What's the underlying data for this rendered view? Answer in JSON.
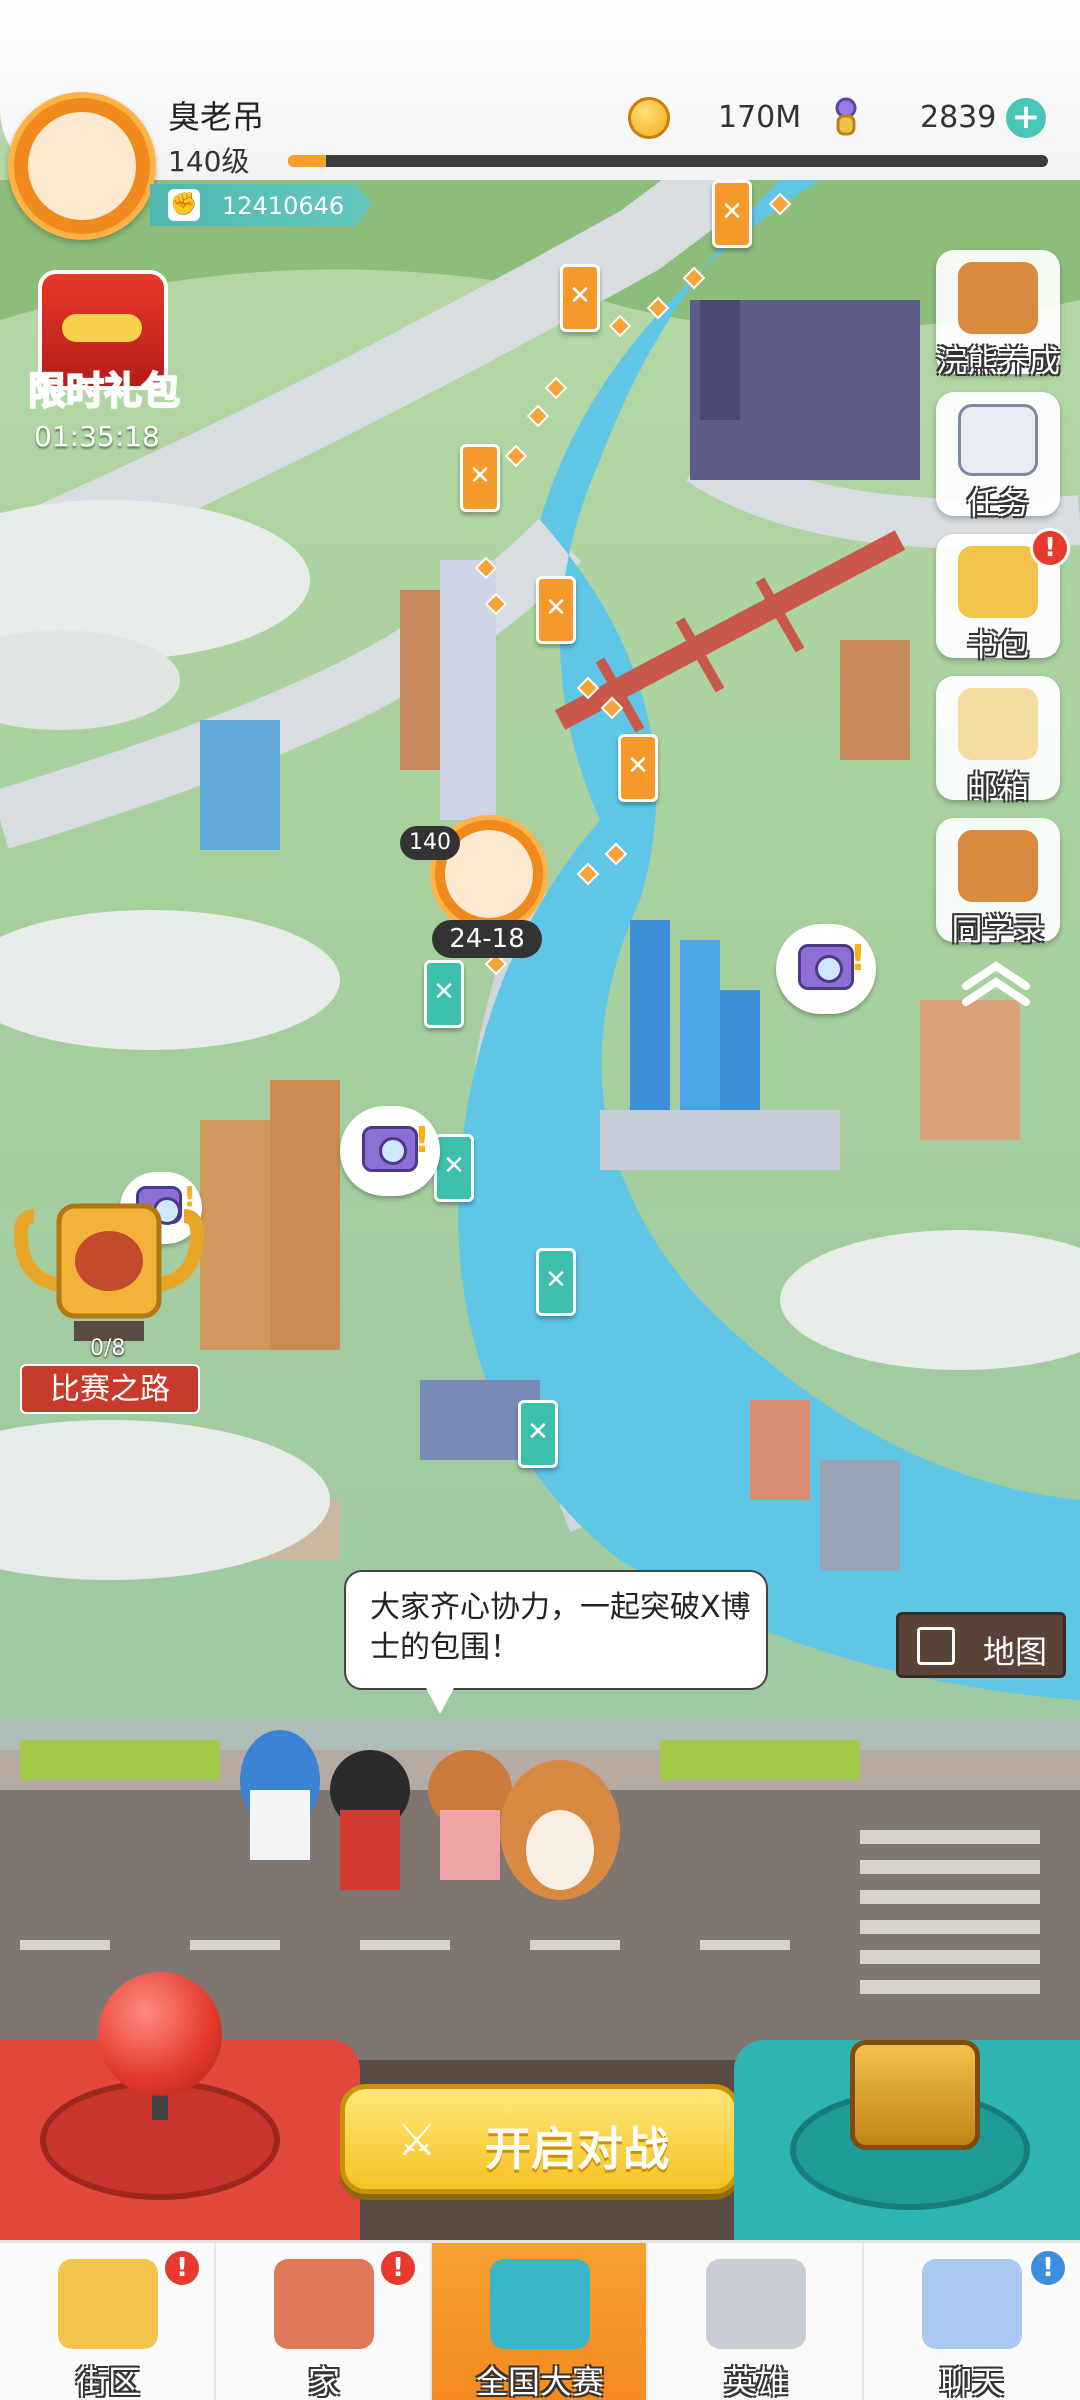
{
  "player": {
    "name": "臭老吊",
    "level_text": "140级",
    "xp_fraction": 0.05,
    "power": "12410646"
  },
  "currency": {
    "coins": "170M",
    "gems": "2839"
  },
  "gift": {
    "label": "限时礼包",
    "timer": "01:35:18"
  },
  "side_menu": {
    "items": [
      {
        "label": "浣熊养成",
        "icon": "raccoon-icon",
        "badge": ""
      },
      {
        "label": "任务",
        "icon": "clipboard-icon",
        "badge": ""
      },
      {
        "label": "书包",
        "icon": "backpack-icon",
        "badge": "!"
      },
      {
        "label": "邮箱",
        "icon": "envelope-icon",
        "badge": ""
      },
      {
        "label": "同学录",
        "icon": "raccoon-book-icon",
        "badge": ""
      }
    ]
  },
  "map": {
    "player_marker_level": "140",
    "current_stage": "24-18",
    "trophy_progress": "0/8",
    "trophy_label": "比赛之路",
    "speech_text": "大家齐心协力，一起突破X博士的包围！",
    "map_sign_label": "地图"
  },
  "fight_button": {
    "label": "开启对战"
  },
  "bottom_nav": {
    "items": [
      {
        "label": "街区",
        "icon": "street-sign-icon",
        "badge": "!"
      },
      {
        "label": "家",
        "icon": "house-icon",
        "badge": "!"
      },
      {
        "label": "全国大赛",
        "icon": "trophy-icon",
        "badge": ""
      },
      {
        "label": "英雄",
        "icon": "hero-cards-icon",
        "badge": ""
      },
      {
        "label": "聊天",
        "icon": "chat-bubble-icon",
        "badge": "!"
      }
    ]
  },
  "colors": {
    "accent_orange": "#f7a132",
    "teal": "#3dbfae",
    "badge_red": "#e83a2c",
    "fight_yellow": "#f6c323"
  }
}
